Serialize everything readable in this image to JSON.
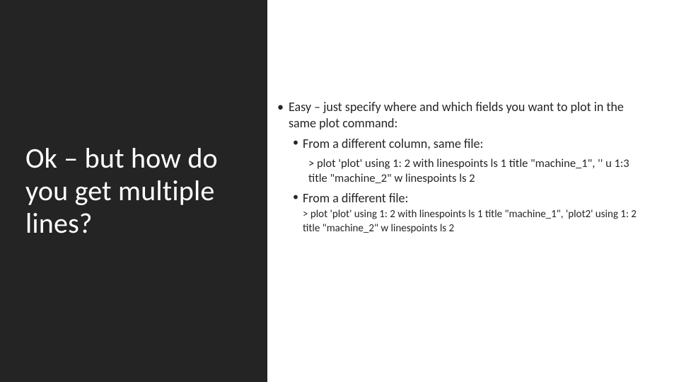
{
  "left": {
    "title": "Ok – but how do you get multiple lines?"
  },
  "right": {
    "main_bullet": "Easy – just specify where and which fields you want to plot in the same plot command:",
    "sub1_label": "From a different column, same file:",
    "sub1_code": "> plot 'plot' using 1: 2 with linespoints ls 1 title \"machine_1\", '' u 1:3 title \"machine_2\" w linespoints ls 2",
    "sub2_label": "From a different file:",
    "sub2_code": "> plot 'plot' using 1: 2 with linespoints ls 1 title \"machine_1\", 'plot2' using 1: 2 title \"machine_2\" w linespoints ls 2"
  }
}
